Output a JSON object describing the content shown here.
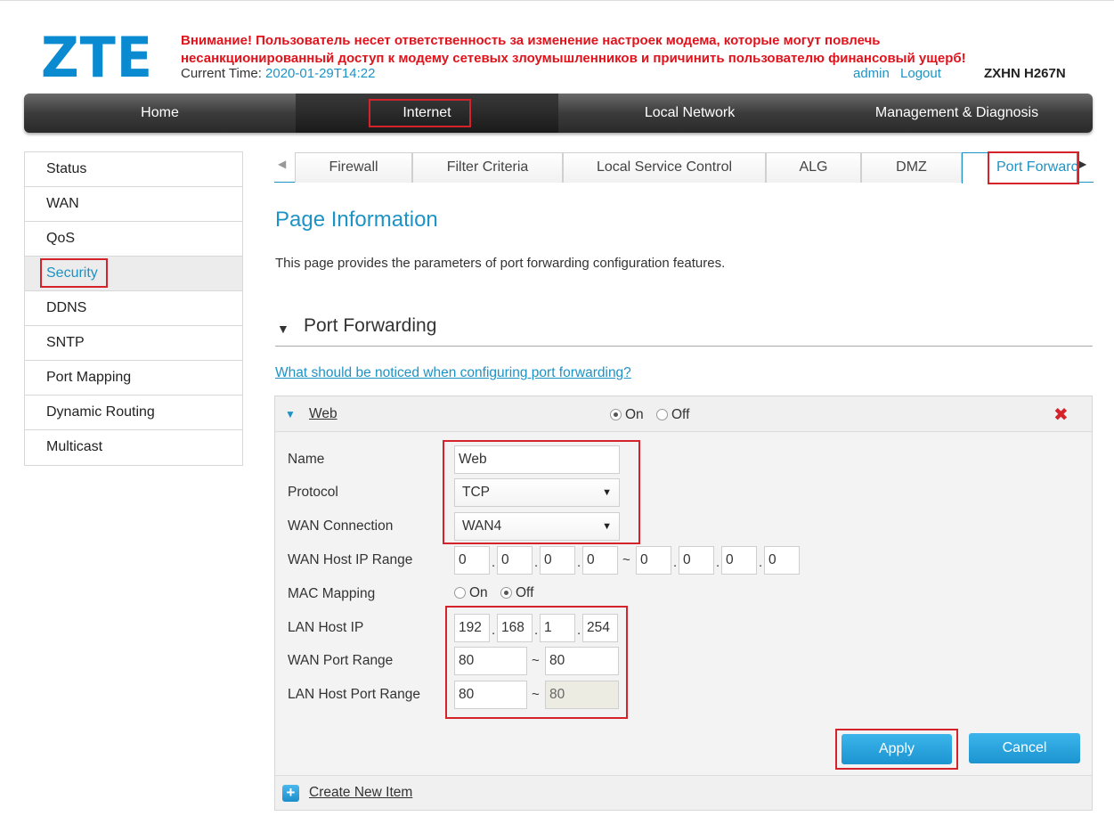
{
  "header": {
    "logo": "ZTE",
    "warning_line1": "Внимание! Пользователь несет ответственность за изменение настроек модема, которые могут повлечь",
    "warning_line2": "несанкционированный доступ к модему сетевых злоумышленников и причинить пользователю финансовый ущерб!",
    "current_time_label": "Current Time: ",
    "current_time_value": "2020-01-29T14:22",
    "user": "admin",
    "logout": "Logout",
    "model": "ZXHN H267N"
  },
  "topnav": {
    "items": [
      {
        "label": "Home"
      },
      {
        "label": "Internet"
      },
      {
        "label": "Local Network"
      },
      {
        "label": "Management & Diagnosis"
      }
    ],
    "active": "Internet"
  },
  "sidebar": {
    "items": [
      {
        "label": "Status"
      },
      {
        "label": "WAN"
      },
      {
        "label": "QoS"
      },
      {
        "label": "Security"
      },
      {
        "label": "DDNS"
      },
      {
        "label": "SNTP"
      },
      {
        "label": "Port Mapping"
      },
      {
        "label": "Dynamic Routing"
      },
      {
        "label": "Multicast"
      }
    ],
    "active": "Security"
  },
  "tabs": {
    "items": [
      {
        "label": "Firewall"
      },
      {
        "label": "Filter Criteria"
      },
      {
        "label": "Local Service Control"
      },
      {
        "label": "ALG"
      },
      {
        "label": "DMZ"
      },
      {
        "label": "Port Forwarc"
      }
    ],
    "active": "Port Forwarc"
  },
  "page": {
    "title": "Page Information",
    "description": "This page provides the parameters of port forwarding configuration features.",
    "section_title": "Port Forwarding",
    "help_link": "What should be noticed when configuring port forwarding?"
  },
  "rule": {
    "name": "Web",
    "enable_on": "On",
    "enable_off": "Off",
    "enabled": true,
    "fields": {
      "name_label": "Name",
      "name_value": "Web",
      "protocol_label": "Protocol",
      "protocol_value": "TCP",
      "wan_conn_label": "WAN Connection",
      "wan_conn_value": "WAN4",
      "wan_host_ip_label": "WAN Host IP Range",
      "wan_host_ip_start": [
        "0",
        "0",
        "0",
        "0"
      ],
      "wan_host_ip_end": [
        "0",
        "0",
        "0",
        "0"
      ],
      "range_sep": "~",
      "mac_mapping_label": "MAC Mapping",
      "mac_on": "On",
      "mac_off": "Off",
      "lan_host_ip_label": "LAN Host IP",
      "lan_host_ip": [
        "192",
        "168",
        "1",
        "254"
      ],
      "wan_port_label": "WAN Port Range",
      "wan_port_start": "80",
      "wan_port_end": "80",
      "lan_port_label": "LAN Host Port Range",
      "lan_port_start": "80",
      "lan_port_end": "80"
    },
    "apply": "Apply",
    "cancel": "Cancel"
  },
  "create_new": "Create New Item",
  "colors": {
    "accent": "#1d93c5",
    "warning": "#e0121b",
    "highlight_box": "#d4232a"
  }
}
